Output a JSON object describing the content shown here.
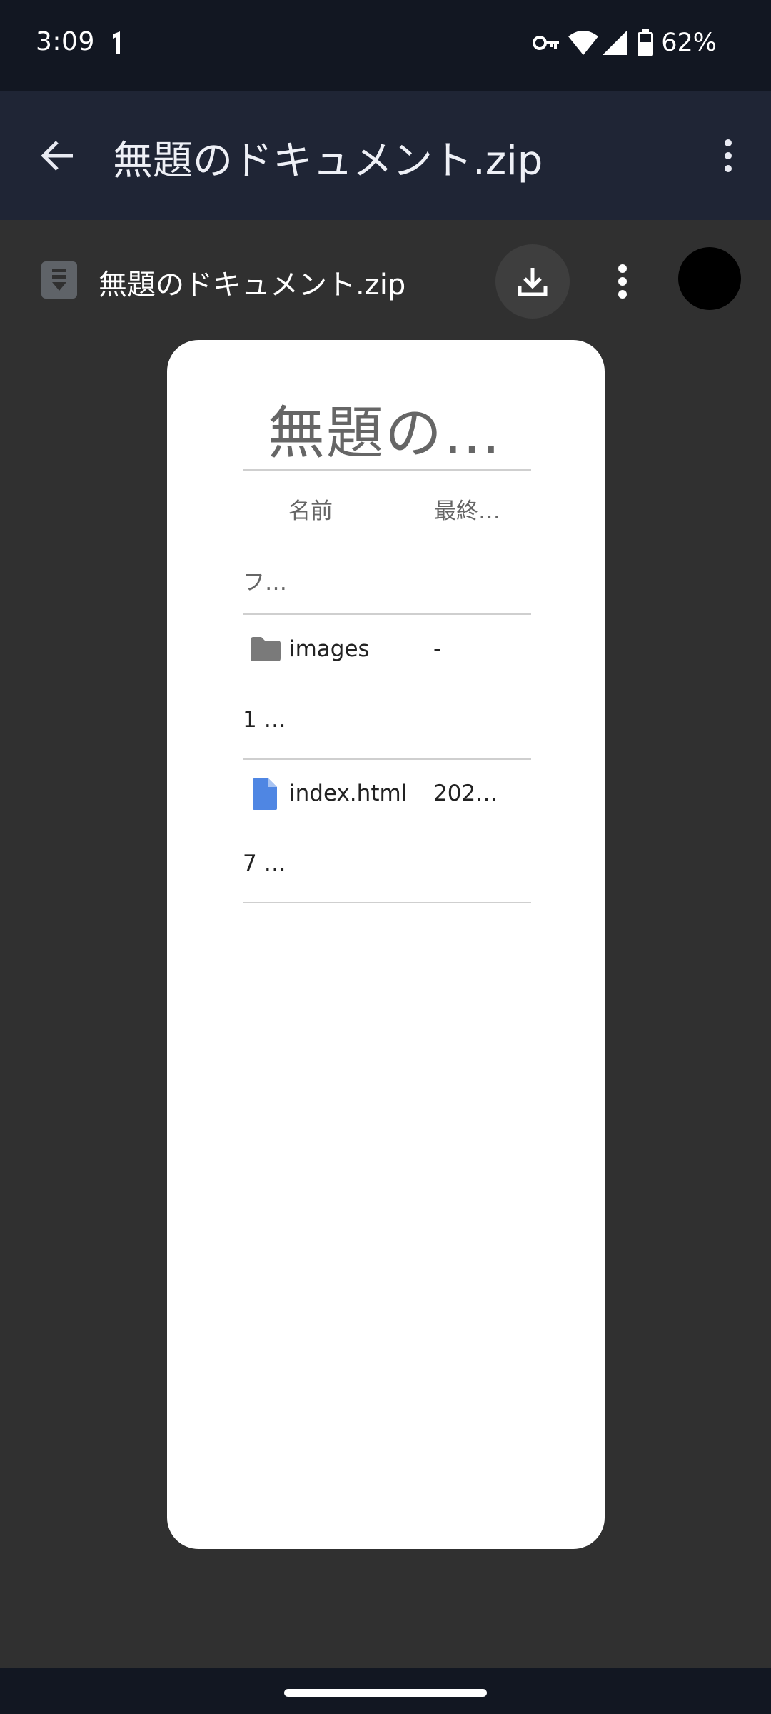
{
  "status_bar": {
    "time": "3:09",
    "battery": "62%",
    "icons": [
      "notification-icon",
      "vpn-key-icon",
      "wifi-icon",
      "cellular-signal-icon",
      "battery-icon"
    ]
  },
  "app_bar": {
    "title": "無題のドキュメント.zip",
    "icons": [
      "back-arrow-icon",
      "more-vert-icon"
    ]
  },
  "viewer": {
    "filename": "無題のドキュメント.zip",
    "icons": [
      "archive-file-icon",
      "download-icon",
      "more-vert-icon"
    ]
  },
  "document": {
    "title": "無題の…",
    "columns": [
      "名前",
      "最終…"
    ],
    "size_header": "フ…",
    "rows": [
      {
        "name": "images",
        "modified": "-",
        "size": "1 …",
        "icon": "folder-icon"
      },
      {
        "name": "index.html",
        "modified": "202…",
        "size": "7 …",
        "icon": "file-icon"
      }
    ]
  },
  "colors": {
    "status_bar": "#121722",
    "app_bar": "#1f2535",
    "viewer_background": "#303030",
    "folder_icon": "#7a7a7a",
    "file_icon": "#4f86e3"
  }
}
